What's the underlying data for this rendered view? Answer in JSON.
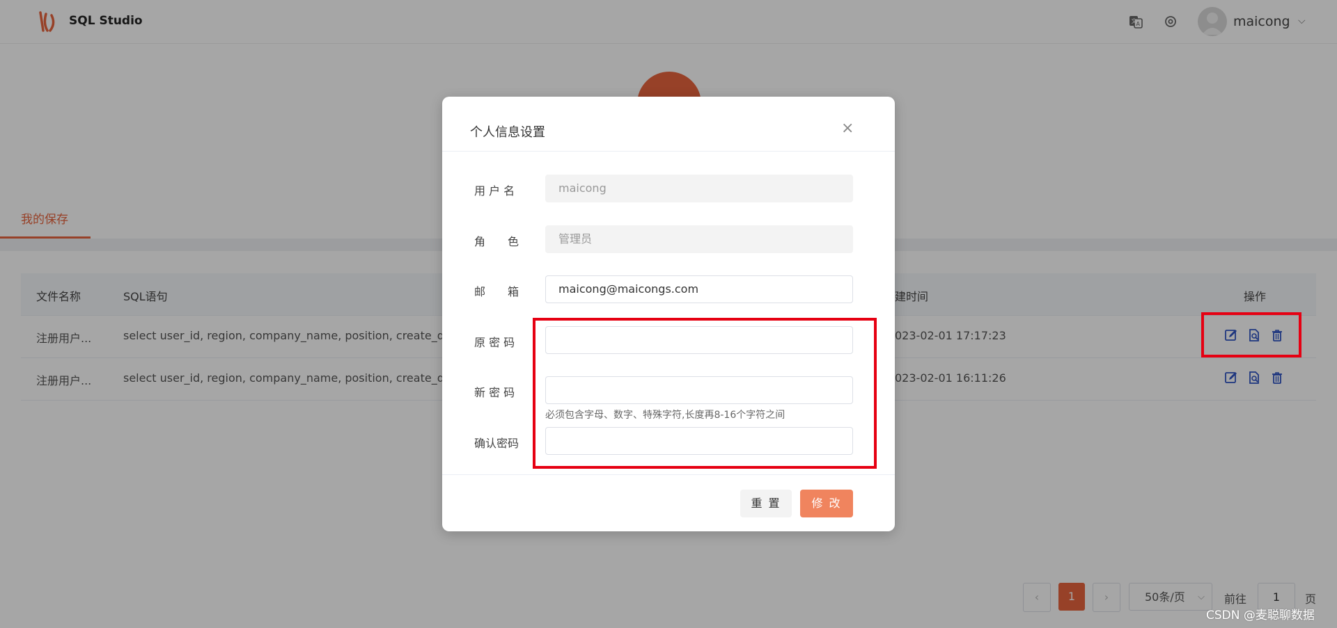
{
  "header": {
    "brand": "SQL Studio",
    "user_name": "maicong"
  },
  "tabs": {
    "my_saved": "我的保存"
  },
  "table": {
    "columns": [
      "文件名称",
      "SQL语句",
      "建时间",
      "操作"
    ],
    "rows": [
      {
        "name": "注册用户...",
        "sql": "select user_id, region, company_name, position, create_date",
        "time": "023-02-01 17:17:23"
      },
      {
        "name": "注册用户...",
        "sql": "select user_id, region, company_name, position, create_date",
        "time": "023-02-01 16:11:26"
      }
    ]
  },
  "pagination": {
    "current_page": "1",
    "page_size": "50条/页",
    "goto_label": "前往",
    "goto_value": "1",
    "page_suffix": "页"
  },
  "watermark": "CSDN @麦聪聊数据",
  "modal": {
    "title": "个人信息设置",
    "close": "×",
    "fields": {
      "username_label": "用 户 名",
      "username_value": "maicong",
      "role_label": "角　　色",
      "role_value": "管理员",
      "email_label": "邮　　箱",
      "email_value": "maicong@maicongs.com",
      "old_password_label": "原 密 码",
      "new_password_label": "新 密 码",
      "confirm_password_label": "确认密码",
      "password_hint": "必须包含字母、数字、特殊字符,长度再8-16个字符之间"
    },
    "reset_label": "重 置",
    "submit_label": "修 改"
  },
  "colors": {
    "accent": "#e8643e",
    "highlight_box": "#e60012",
    "icon_blue": "#2f54c4"
  }
}
